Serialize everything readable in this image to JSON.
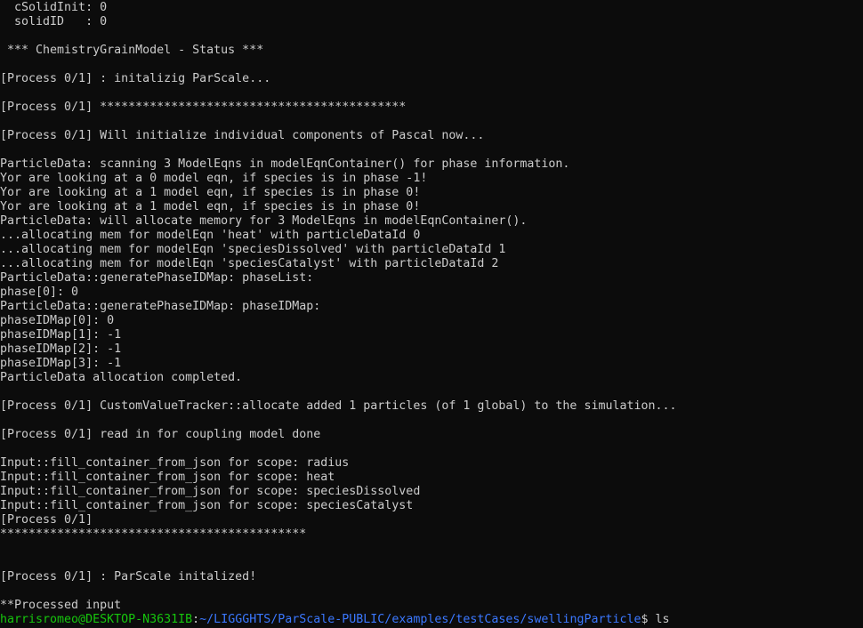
{
  "terminal": {
    "lines": [
      "  cSolidInit: 0",
      "  solidID   : 0",
      "",
      " *** ChemistryGrainModel - Status ***",
      "",
      "[Process 0/1] : initalizig ParScale...",
      "",
      "[Process 0/1] *******************************************",
      "",
      "[Process 0/1] Will initialize individual components of Pascal now...",
      "",
      "ParticleData: scanning 3 ModelEqns in modelEqnContainer() for phase information.",
      "Yor are looking at a 0 model eqn, if species is in phase -1!",
      "Yor are looking at a 1 model eqn, if species is in phase 0!",
      "Yor are looking at a 1 model eqn, if species is in phase 0!",
      "ParticleData: will allocate memory for 3 ModelEqns in modelEqnContainer().",
      "...allocating mem for modelEqn 'heat' with particleDataId 0",
      "...allocating mem for modelEqn 'speciesDissolved' with particleDataId 1",
      "...allocating mem for modelEqn 'speciesCatalyst' with particleDataId 2",
      "ParticleData::generatePhaseIDMap: phaseList:",
      "phase[0]: 0",
      "ParticleData::generatePhaseIDMap: phaseIDMap:",
      "phaseIDMap[0]: 0",
      "phaseIDMap[1]: -1",
      "phaseIDMap[2]: -1",
      "phaseIDMap[3]: -1",
      "ParticleData allocation completed.",
      "",
      "[Process 0/1] CustomValueTracker::allocate added 1 particles (of 1 global) to the simulation...",
      "",
      "[Process 0/1] read in for coupling model done",
      "",
      "Input::fill_container_from_json for scope: radius",
      "Input::fill_container_from_json for scope: heat",
      "Input::fill_container_from_json for scope: speciesDissolved",
      "Input::fill_container_from_json for scope: speciesCatalyst",
      "[Process 0/1]",
      "*******************************************",
      "",
      "",
      "[Process 0/1] : ParScale initalized!",
      "",
      "**Processed input"
    ],
    "prompt": {
      "user_host": "harrisromeo@DESKTOP-N3631IB",
      "separator": ":",
      "path": "~/LIGGGHTS/ParScale-PUBLIC/examples/testCases/swellingParticle",
      "dollar": "$ ",
      "command": "ls"
    },
    "colors": {
      "background": "#0c0c0c",
      "text": "#cccccc",
      "user_host": "#16c60c",
      "path": "#3b78ff"
    }
  }
}
